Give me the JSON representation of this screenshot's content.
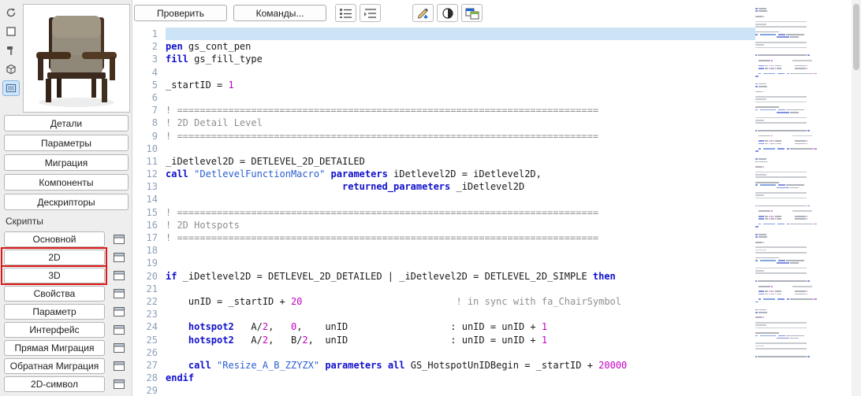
{
  "toolbar": {
    "check_label": "Проверить",
    "commands_label": "Команды...",
    "icons": [
      "numbered-list-icon",
      "indented-list-icon",
      "pen-arrow-icon",
      "contrast-icon",
      "window-split-icon"
    ]
  },
  "sidebar": {
    "preview": "chair-3d-preview",
    "strip_icons": [
      "rotate-view-icon",
      "plan-view-icon",
      "tool-view-icon",
      "axon-view-icon",
      "list-view-icon"
    ],
    "strip_selected_index": 4,
    "nav_buttons": [
      "Детали",
      "Параметры",
      "Миграция",
      "Компоненты",
      "Дескрипторы"
    ],
    "scripts_label": "Скрипты",
    "script_buttons": [
      {
        "label": "Основной",
        "highlight": false
      },
      {
        "label": "2D",
        "highlight": true
      },
      {
        "label": "3D",
        "highlight": true
      },
      {
        "label": "Свойства",
        "highlight": false
      },
      {
        "label": "Параметр",
        "highlight": false
      },
      {
        "label": "Интерфейс",
        "highlight": false
      },
      {
        "label": "Прямая Миграция",
        "highlight": false
      },
      {
        "label": "Обратная Миграция",
        "highlight": false
      },
      {
        "label": "2D-символ",
        "highlight": false
      }
    ]
  },
  "editor": {
    "selected_line": 1,
    "colors": {
      "keyword": "#1010cc",
      "string": "#2a5fd0",
      "number": "#c400c4",
      "comment": "#8f8f8f",
      "text": "#1a1a1a",
      "selection": "#cde4f7",
      "line_number": "#8ca0b8"
    },
    "lines": [
      {
        "n": 1,
        "sel": true,
        "toks": []
      },
      {
        "n": 2,
        "toks": [
          [
            "k",
            "pen"
          ],
          [
            "t",
            " gs_cont_pen"
          ]
        ]
      },
      {
        "n": 3,
        "toks": [
          [
            "k",
            "fill"
          ],
          [
            "t",
            " gs_fill_type"
          ]
        ]
      },
      {
        "n": 4,
        "toks": []
      },
      {
        "n": 5,
        "toks": [
          [
            "t",
            "_startID = "
          ],
          [
            "n",
            "1"
          ]
        ]
      },
      {
        "n": 6,
        "toks": []
      },
      {
        "n": 7,
        "toks": [
          [
            "c",
            "! =========================================================================="
          ]
        ]
      },
      {
        "n": 8,
        "toks": [
          [
            "c",
            "! 2D Detail Level"
          ]
        ]
      },
      {
        "n": 9,
        "toks": [
          [
            "c",
            "! =========================================================================="
          ]
        ]
      },
      {
        "n": 10,
        "toks": []
      },
      {
        "n": 11,
        "toks": [
          [
            "t",
            "_iDetlevel2D = DETLEVEL_2D_DETAILED"
          ]
        ]
      },
      {
        "n": 12,
        "toks": [
          [
            "k",
            "call"
          ],
          [
            "t",
            " "
          ],
          [
            "s",
            "\"DetlevelFunctionMacro\""
          ],
          [
            "t",
            " "
          ],
          [
            "k",
            "parameters"
          ],
          [
            "t",
            " iDetlevel2D = iDetlevel2D,"
          ]
        ]
      },
      {
        "n": 13,
        "toks": [
          [
            "t",
            "                               "
          ],
          [
            "k",
            "returned_parameters"
          ],
          [
            "t",
            " _iDetlevel2D"
          ]
        ]
      },
      {
        "n": 14,
        "toks": []
      },
      {
        "n": 15,
        "toks": [
          [
            "c",
            "! =========================================================================="
          ]
        ]
      },
      {
        "n": 16,
        "toks": [
          [
            "c",
            "! 2D Hotspots"
          ]
        ]
      },
      {
        "n": 17,
        "toks": [
          [
            "c",
            "! =========================================================================="
          ]
        ]
      },
      {
        "n": 18,
        "toks": []
      },
      {
        "n": 19,
        "toks": []
      },
      {
        "n": 20,
        "toks": [
          [
            "k",
            "if"
          ],
          [
            "t",
            " _iDetlevel2D = DETLEVEL_2D_DETAILED | _iDetlevel2D = DETLEVEL_2D_SIMPLE "
          ],
          [
            "k",
            "then"
          ]
        ]
      },
      {
        "n": 21,
        "toks": []
      },
      {
        "n": 22,
        "toks": [
          [
            "t",
            "    "
          ],
          [
            "t",
            "unID = _startID + "
          ],
          [
            "n",
            "20"
          ],
          [
            "t",
            "                           "
          ],
          [
            "c",
            "! in sync with fa_ChairSymbol"
          ]
        ]
      },
      {
        "n": 23,
        "toks": []
      },
      {
        "n": 24,
        "toks": [
          [
            "t",
            "    "
          ],
          [
            "k",
            "hotspot2"
          ],
          [
            "t",
            "   A/"
          ],
          [
            "n",
            "2"
          ],
          [
            "t",
            ",   "
          ],
          [
            "n",
            "0"
          ],
          [
            "t",
            ",    unID"
          ],
          [
            "t",
            "                  "
          ],
          [
            "t",
            ": unID = unID + "
          ],
          [
            "n",
            "1"
          ]
        ]
      },
      {
        "n": 25,
        "toks": [
          [
            "t",
            "    "
          ],
          [
            "k",
            "hotspot2"
          ],
          [
            "t",
            "   A/"
          ],
          [
            "n",
            "2"
          ],
          [
            "t",
            ",   B/"
          ],
          [
            "n",
            "2"
          ],
          [
            "t",
            ",  unID"
          ],
          [
            "t",
            "                  "
          ],
          [
            "t",
            ": unID = unID + "
          ],
          [
            "n",
            "1"
          ]
        ]
      },
      {
        "n": 26,
        "toks": []
      },
      {
        "n": 27,
        "toks": [
          [
            "t",
            "    "
          ],
          [
            "k",
            "call"
          ],
          [
            "t",
            " "
          ],
          [
            "s",
            "\"Resize_A_B_ZZYZX\""
          ],
          [
            "t",
            " "
          ],
          [
            "k",
            "parameters"
          ],
          [
            "t",
            " "
          ],
          [
            "k",
            "all"
          ],
          [
            "t",
            " GS_HotspotUnIDBegin = _startID + "
          ],
          [
            "n",
            "20000"
          ]
        ]
      },
      {
        "n": 28,
        "toks": [
          [
            "k",
            "endif"
          ]
        ]
      },
      {
        "n": 29,
        "toks": []
      }
    ]
  }
}
